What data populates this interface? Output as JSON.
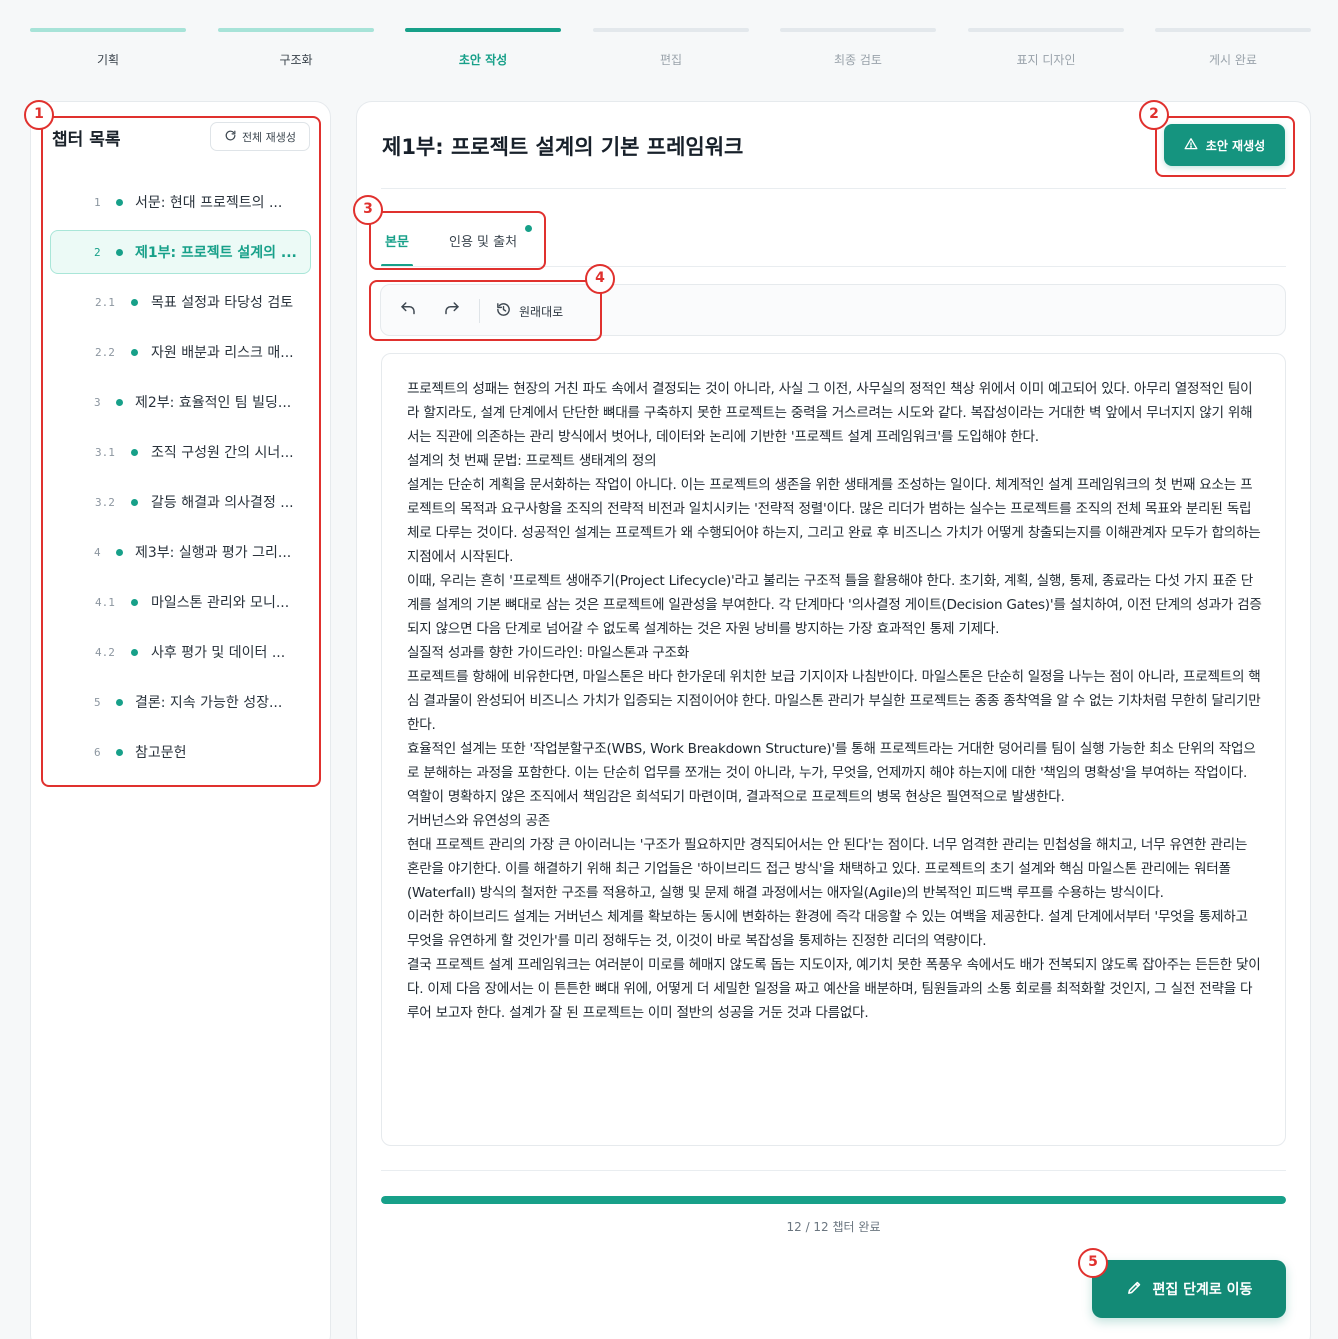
{
  "stepper": {
    "steps": [
      {
        "label": "기획",
        "state": "done"
      },
      {
        "label": "구조화",
        "state": "done"
      },
      {
        "label": "초안 작성",
        "state": "active"
      },
      {
        "label": "편집",
        "state": "pending"
      },
      {
        "label": "최종 검토",
        "state": "pending"
      },
      {
        "label": "표지 디자인",
        "state": "pending"
      },
      {
        "label": "게시 완료",
        "state": "pending"
      }
    ]
  },
  "sidebar": {
    "title": "챕터 목록",
    "regen_all_label": "전체 재생성",
    "regen_all_icon": "refresh-icon",
    "chapters": [
      {
        "num": "1",
        "title": "서문: 현대 프로젝트의 ...",
        "level": "top",
        "active": false
      },
      {
        "num": "2",
        "title": "제1부: 프로젝트 설계의 ...",
        "level": "top",
        "active": true
      },
      {
        "num": "2.1",
        "title": "목표 설정과 타당성 검토",
        "level": "sub",
        "active": false
      },
      {
        "num": "2.2",
        "title": "자원 배분과 리스크 매...",
        "level": "sub",
        "active": false
      },
      {
        "num": "3",
        "title": "제2부: 효율적인 팀 빌딩...",
        "level": "top",
        "active": false
      },
      {
        "num": "3.1",
        "title": "조직 구성원 간의 시너...",
        "level": "sub",
        "active": false
      },
      {
        "num": "3.2",
        "title": "갈등 해결과 의사결정 ...",
        "level": "sub",
        "active": false
      },
      {
        "num": "4",
        "title": "제3부: 실행과 평가 그리...",
        "level": "top",
        "active": false
      },
      {
        "num": "4.1",
        "title": "마일스톤 관리와 모니...",
        "level": "sub",
        "active": false
      },
      {
        "num": "4.2",
        "title": "사후 평가 및 데이터 ...",
        "level": "sub",
        "active": false
      },
      {
        "num": "5",
        "title": "결론: 지속 가능한 성장...",
        "level": "top",
        "active": false
      },
      {
        "num": "6",
        "title": "참고문헌",
        "level": "top",
        "active": false
      }
    ]
  },
  "main": {
    "title": "제1부: 프로젝트 설계의 기본 프레임워크",
    "regen_draft_label": "초안 재생성",
    "regen_draft_icon": "warning-triangle-icon",
    "tabs": [
      {
        "label": "본문",
        "active": true
      },
      {
        "label": "인용 및 출처",
        "active": false,
        "has_indicator": true
      }
    ],
    "toolbar": {
      "undo_icon": "undo-icon",
      "redo_icon": "redo-icon",
      "reset_icon": "reset-icon",
      "reset_label": "원래대로"
    },
    "paragraphs": [
      "프로젝트의 성패는 현장의 거친 파도 속에서 결정되는 것이 아니라, 사실 그 이전, 사무실의 정적인 책상 위에서 이미 예고되어 있다. 아무리 열정적인 팀이라 할지라도, 설계 단계에서 단단한 뼈대를 구축하지 못한 프로젝트는 중력을 거스르려는 시도와 같다. 복잡성이라는 거대한 벽 앞에서 무너지지 않기 위해서는 직관에 의존하는 관리 방식에서 벗어나, 데이터와 논리에 기반한 '프로젝트 설계 프레임워크'를 도입해야 한다.",
      "설계의 첫 번째 문법: 프로젝트 생태계의 정의",
      "설계는 단순히 계획을 문서화하는 작업이 아니다. 이는 프로젝트의 생존을 위한 생태계를 조성하는 일이다. 체계적인 설계 프레임워크의 첫 번째 요소는 프로젝트의 목적과 요구사항을 조직의 전략적 비전과 일치시키는 '전략적 정렬'이다. 많은 리더가 범하는 실수는 프로젝트를 조직의 전체 목표와 분리된 독립체로 다루는 것이다. 성공적인 설계는 프로젝트가 왜 수행되어야 하는지, 그리고 완료 후 비즈니스 가치가 어떻게 창출되는지를 이해관계자 모두가 합의하는 지점에서 시작된다.",
      "이때, 우리는 흔히 '프로젝트 생애주기(Project Lifecycle)'라고 불리는 구조적 틀을 활용해야 한다. 초기화, 계획, 실행, 통제, 종료라는 다섯 가지 표준 단계를 설계의 기본 뼈대로 삼는 것은 프로젝트에 일관성을 부여한다. 각 단계마다 '의사결정 게이트(Decision Gates)'를 설치하여, 이전 단계의 성과가 검증되지 않으면 다음 단계로 넘어갈 수 없도록 설계하는 것은 자원 낭비를 방지하는 가장 효과적인 통제 기제다.",
      "실질적 성과를 향한 가이드라인: 마일스톤과 구조화",
      "프로젝트를 항해에 비유한다면, 마일스톤은 바다 한가운데 위치한 보급 기지이자 나침반이다. 마일스톤은 단순히 일정을 나누는 점이 아니라, 프로젝트의 핵심 결과물이 완성되어 비즈니스 가치가 입증되는 지점이어야 한다. 마일스톤 관리가 부실한 프로젝트는 종종 종착역을 알 수 없는 기차처럼 무한히 달리기만 한다.",
      "효율적인 설계는 또한 '작업분할구조(WBS, Work Breakdown Structure)'를 통해 프로젝트라는 거대한 덩어리를 팀이 실행 가능한 최소 단위의 작업으로 분해하는 과정을 포함한다. 이는 단순히 업무를 쪼개는 것이 아니라, 누가, 무엇을, 언제까지 해야 하는지에 대한 '책임의 명확성'을 부여하는 작업이다. 역할이 명확하지 않은 조직에서 책임감은 희석되기 마련이며, 결과적으로 프로젝트의 병목 현상은 필연적으로 발생한다.",
      "거버넌스와 유연성의 공존",
      "현대 프로젝트 관리의 가장 큰 아이러니는 '구조가 필요하지만 경직되어서는 안 된다'는 점이다. 너무 엄격한 관리는 민첩성을 해치고, 너무 유연한 관리는 혼란을 야기한다. 이를 해결하기 위해 최근 기업들은 '하이브리드 접근 방식'을 채택하고 있다. 프로젝트의 초기 설계와 핵심 마일스톤 관리에는 워터폴(Waterfall) 방식의 철저한 구조를 적용하고, 실행 및 문제 해결 과정에서는 애자일(Agile)의 반복적인 피드백 루프를 수용하는 방식이다.",
      "이러한 하이브리드 설계는 거버넌스 체계를 확보하는 동시에 변화하는 환경에 즉각 대응할 수 있는 여백을 제공한다. 설계 단계에서부터 '무엇을 통제하고 무엇을 유연하게 할 것인가'를 미리 정해두는 것, 이것이 바로 복잡성을 통제하는 진정한 리더의 역량이다.",
      "결국 프로젝트 설계 프레임워크는 여러분이 미로를 헤매지 않도록 돕는 지도이자, 예기치 못한 폭풍우 속에서도 배가 전복되지 않도록 잡아주는 든든한 닻이다. 이제 다음 장에서는 이 튼튼한 뼈대 위에, 어떻게 더 세밀한 일정을 짜고 예산을 배분하며, 팀원들과의 소통 회로를 최적화할 것인지, 그 실전 전략을 다루어 보고자 한다. 설계가 잘 된 프로젝트는 이미 절반의 성공을 거둔 것과 다름없다."
    ],
    "progress": {
      "fraction": 1.0,
      "label": "12 / 12 챕터 완료"
    },
    "go_edit_label": "편집 단계로 이동",
    "go_edit_icon": "pencil-icon"
  },
  "annotations": [
    "1",
    "2",
    "3",
    "4",
    "5"
  ],
  "colors": {
    "accent": "#17a089",
    "accent_dark": "#138a76",
    "annotation_red": "#e0312e",
    "done_bar": "#a7e3d8"
  }
}
